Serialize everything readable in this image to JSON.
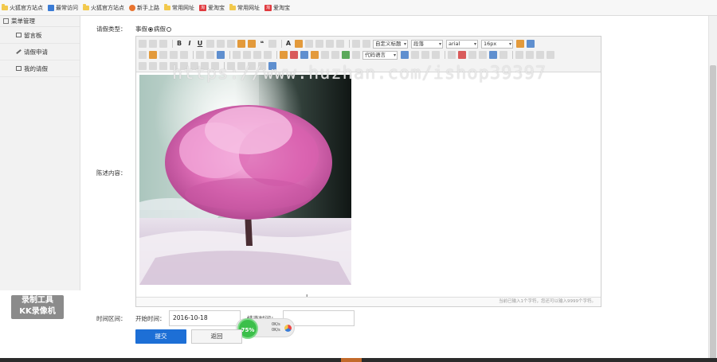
{
  "bookmarks": [
    {
      "label": "火狐官方站点",
      "icon": "folder-icon"
    },
    {
      "label": "最常访问",
      "icon": "page-icon"
    },
    {
      "label": "火狐官方站点",
      "icon": "folder-icon"
    },
    {
      "label": "新手上路",
      "icon": "firefox-icon"
    },
    {
      "label": "常用网址",
      "icon": "folder-icon"
    },
    {
      "label": "爱淘宝",
      "icon": "taobao-icon"
    },
    {
      "label": "常用网址",
      "icon": "folder-icon"
    },
    {
      "label": "爱淘宝",
      "icon": "taobao-icon"
    }
  ],
  "sidebar": {
    "header": "菜单管理",
    "items": [
      {
        "label": "留言板"
      },
      {
        "label": "请假申请"
      },
      {
        "label": "我的请假"
      }
    ]
  },
  "badge": {
    "line1": "录制工具",
    "line2": "KK录像机"
  },
  "watermark": "https://www.huzhan.com/ishop39397",
  "form": {
    "leave_type_label": "请假类型：",
    "option_personal": "事假",
    "option_sick": "病假",
    "content_label": "陈述内容：",
    "time_label": "时间区间：",
    "start_label": "开始时间：",
    "start_value": "2016-10-18",
    "end_label": "结束时间：",
    "end_value": "",
    "submit_label": "提交",
    "back_label": "返回"
  },
  "editor": {
    "paragraph_select": "段落",
    "font_family_select": "arial",
    "font_size_select": "16px",
    "heading_select": "自定义标题",
    "code_lang_select": "代码语言",
    "status_text": "当前已输入1个字符，您还可以输入9999个字符。"
  },
  "speed_widget": {
    "percent": "75%",
    "up": "0K/s",
    "down": "0K/s"
  }
}
